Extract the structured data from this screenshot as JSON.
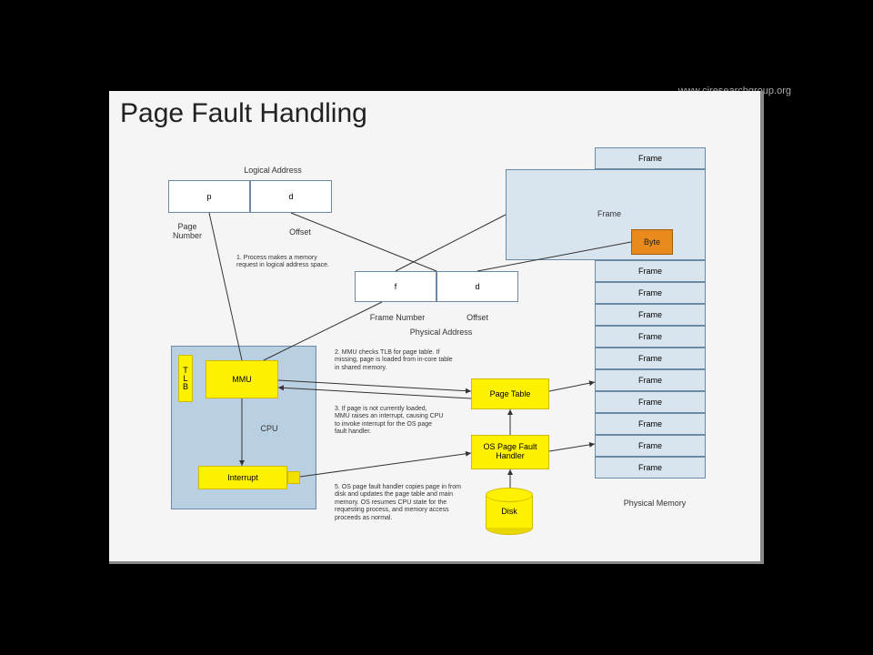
{
  "watermark": "www.ciresearchgroup.org",
  "title": "Page Fault Handling",
  "logical": {
    "header": "Logical Address",
    "p": "p",
    "d": "d",
    "pageNumLabel": "Page\nNumber",
    "offsetLabel": "Offset"
  },
  "physical": {
    "f": "f",
    "d": "d",
    "frameNumLabel": "Frame Number",
    "offsetLabel": "Offset",
    "header": "Physical Address"
  },
  "notes": {
    "n1": "1. Process makes a memory request in logical address space.",
    "n2": "2. MMU checks TLB for page table. If missing, page is loaded from in-core table in shared memory.",
    "n3": "3. If page is not currently loaded, MMU raises an interrupt, causing CPU to invoke interrupt for the OS page fault handler.",
    "n4": "5. OS page fault handler copies page in from disk and updates the page table and main memory. OS resumes CPU state for the requesting process, and memory access proceeds as normal."
  },
  "cpu": {
    "tlb": "T\nL\nB",
    "mmu": "MMU",
    "cpuLabel": "CPU",
    "interrupt": "Interrupt"
  },
  "mid": {
    "pageTable": "Page Table",
    "handler": "OS Page Fault\nHandler",
    "disk": "Disk"
  },
  "memory": {
    "label": "Physical Memory",
    "frameTop": "Frame",
    "largeFrame": "Frame",
    "byte": "Byte",
    "frames": [
      "Frame",
      "Frame",
      "Frame",
      "Frame",
      "Frame",
      "Frame",
      "Frame",
      "Frame",
      "Frame",
      "Frame"
    ]
  }
}
